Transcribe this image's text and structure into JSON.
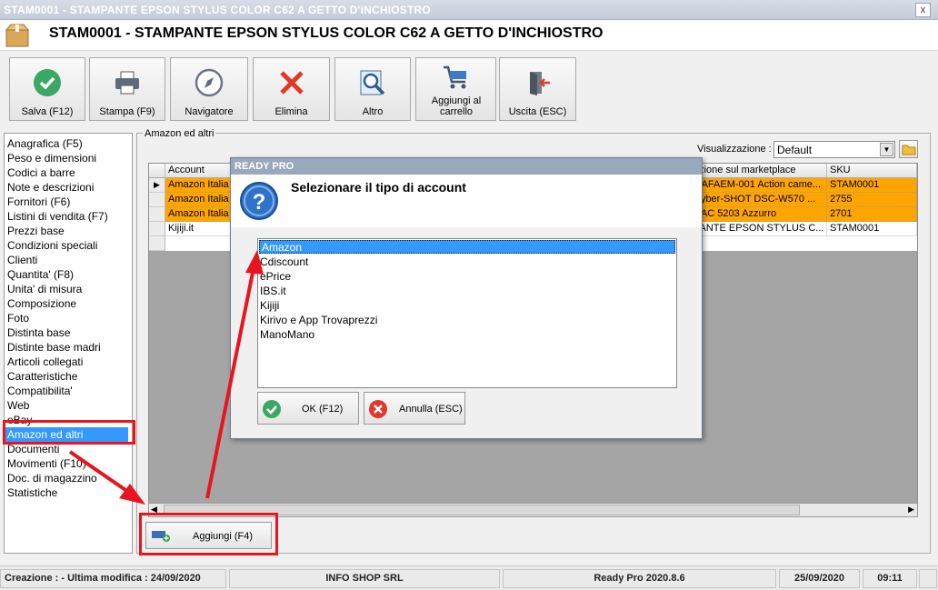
{
  "window": {
    "title": "STAM0001 - STAMPANTE EPSON STYLUS COLOR C62 A GETTO D'INCHIOSTRO",
    "close_label": "x"
  },
  "header": {
    "title": "STAM0001 - STAMPANTE EPSON STYLUS COLOR C62 A GETTO D'INCHIOSTRO"
  },
  "toolbar": [
    {
      "label": "Salva (F12)",
      "icon": "check-icon"
    },
    {
      "label": "Stampa (F9)",
      "icon": "printer-icon"
    },
    {
      "label": "Navigatore",
      "icon": "compass-icon"
    },
    {
      "label": "Elimina",
      "icon": "delete-x-icon"
    },
    {
      "label": "Altro",
      "icon": "magnifier-icon"
    },
    {
      "label": "Aggiungi al carrello",
      "icon": "cart-icon"
    },
    {
      "label": "Uscita (ESC)",
      "icon": "exit-door-icon"
    }
  ],
  "sidebar": {
    "items": [
      "Anagrafica (F5)",
      "Peso e dimensioni",
      "Codici a barre",
      "Note e descrizioni",
      "Fornitori (F6)",
      "Listini di vendita (F7)",
      "Prezzi base",
      "Condizioni speciali",
      "Clienti",
      "Quantita' (F8)",
      "Unita' di misura",
      "Composizione",
      "Foto",
      "Distinta base",
      "Distinte base madri",
      "Articoli collegati",
      "Caratteristiche",
      "Compatibilita'",
      "Web",
      "eBay",
      "Amazon ed altri",
      "Documenti",
      "Movimenti (F10)",
      "Doc. di magazzino",
      "Statistiche"
    ],
    "selected": "Amazon ed altri"
  },
  "panel": {
    "caption": "Amazon ed altri",
    "view_label": "Visualizzazione :",
    "view_value": "Default"
  },
  "grid": {
    "columns": [
      "Account",
      "rizione sul marketplace",
      "SKU"
    ],
    "rows": [
      {
        "account": "Amazon Italia",
        "desc": "o AFAEM-001 Action came...",
        "sku": "STAM0001",
        "highlight": true
      },
      {
        "account": "Amazon Italia",
        "desc": "Cyber-SHOT DSC-W570 ...",
        "sku": "2755",
        "highlight": true
      },
      {
        "account": "Amazon Italia",
        "desc": "RAC 5203 Azzurro",
        "sku": "2701",
        "highlight": true
      },
      {
        "account": "Kijiji.it",
        "desc": "PANTE EPSON STYLUS C...",
        "sku": "STAM0001",
        "highlight": false
      }
    ],
    "highlight_color": "#ffa500"
  },
  "dialog": {
    "title": "READY PRO",
    "prompt": "Selezionare il tipo di account",
    "options": [
      "Amazon",
      "Cdiscount",
      "ePrice",
      "IBS.it",
      "Kijiji",
      "Kirivo e App Trovaprezzi",
      "ManoMano"
    ],
    "selected": "Amazon",
    "ok_label": "OK (F12)",
    "cancel_label": "Annulla (ESC)"
  },
  "add_button": {
    "label": "Aggiungi (F4)"
  },
  "status": {
    "created": "Creazione :  - Ultima modifica : 24/09/2020",
    "company": "INFO SHOP SRL",
    "version": "Ready Pro 2020.8.6",
    "date": "25/09/2020",
    "time": "09:11"
  },
  "annotations": {
    "color": "#e8141e"
  }
}
